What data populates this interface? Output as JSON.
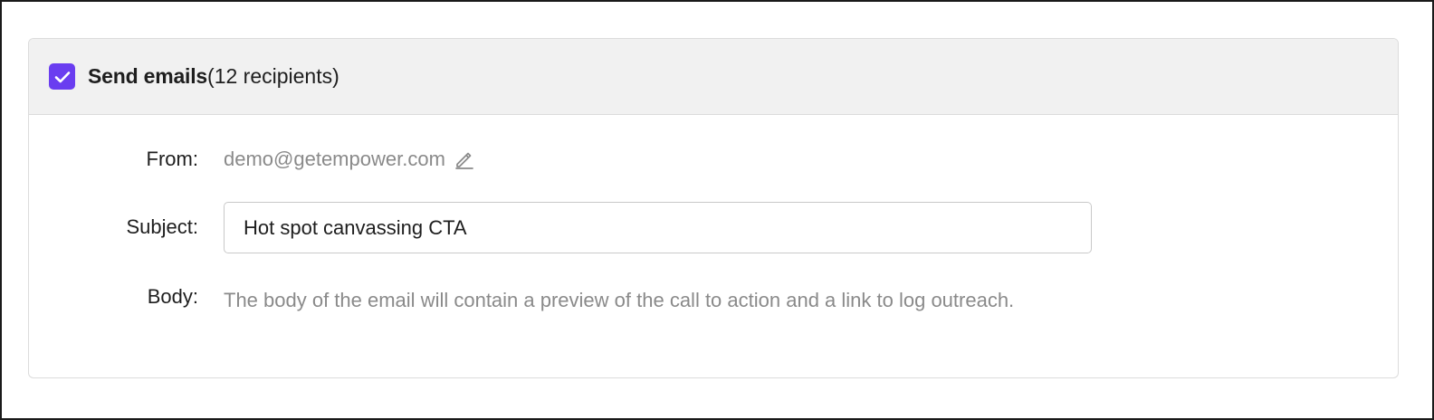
{
  "email_section": {
    "title": "Send emails",
    "recipient_count": "(12 recipients)",
    "checkbox_checked": true,
    "accent_color": "#6a3df0",
    "checkbox_icon": "check-icon"
  },
  "form": {
    "from_label": "From:",
    "from_value": "demo@getempower.com",
    "from_edit_icon": "pencil-icon",
    "subject_label": "Subject:",
    "subject_value": "Hot spot canvassing CTA",
    "body_label": "Body:",
    "body_text": "The body of the email will contain a preview of the call to action and a link to log outreach."
  }
}
